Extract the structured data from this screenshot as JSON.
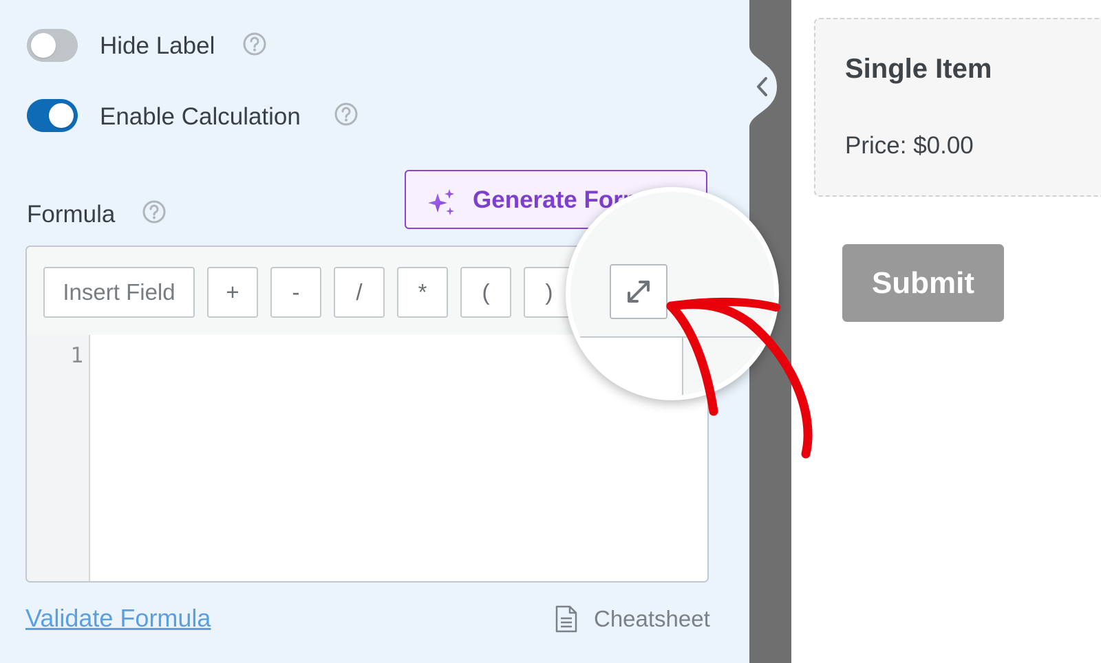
{
  "settings": {
    "hide_label": {
      "label": "Hide Label",
      "enabled": false
    },
    "enable_calculation": {
      "label": "Enable Calculation",
      "enabled": true
    }
  },
  "formula": {
    "title": "Formula",
    "generate_button": "Generate Formula",
    "toolbar": {
      "insert_field": "Insert Field",
      "operators": [
        "+",
        "-",
        "/",
        "*",
        "(",
        ")"
      ]
    },
    "line_number": "1",
    "validate_link": "Validate Formula",
    "cheatsheet_link": "Cheatsheet"
  },
  "preview": {
    "item_title": "Single Item",
    "item_price": "Price: $0.00",
    "submit_label": "Submit"
  },
  "colors": {
    "panel_bg": "#ebf3fc",
    "toggle_on": "#0e6bb5",
    "ai_purple": "#7c3fd0",
    "link_blue": "#5aa0e0",
    "annotation_red": "#e8000b",
    "submit_gray": "#999999"
  },
  "icons": [
    "help-icon",
    "sparkles-icon",
    "expand-icon",
    "document-icon",
    "chevron-left-icon"
  ]
}
